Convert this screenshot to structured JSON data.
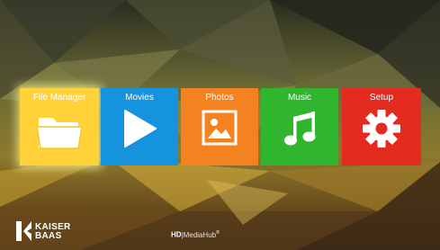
{
  "menu": {
    "items": [
      {
        "label": "File Manager",
        "icon": "folder-icon",
        "color": "#ffd23a",
        "selected": true
      },
      {
        "label": "Movies",
        "icon": "play-icon",
        "color": "#1593dd",
        "selected": false
      },
      {
        "label": "Photos",
        "icon": "image-icon",
        "color": "#f58220",
        "selected": false
      },
      {
        "label": "Music",
        "icon": "music-note-icon",
        "color": "#2fb52e",
        "selected": false
      },
      {
        "label": "Setup",
        "icon": "gear-icon",
        "color": "#e32b1f",
        "selected": false
      }
    ]
  },
  "brand": {
    "line1": "KAISER",
    "line2": "BAAS",
    "icon": "kaiser-baas-logo-icon"
  },
  "product": {
    "prefix": "HD",
    "divider": "|",
    "name": "MediaHub",
    "trademark": "®"
  }
}
